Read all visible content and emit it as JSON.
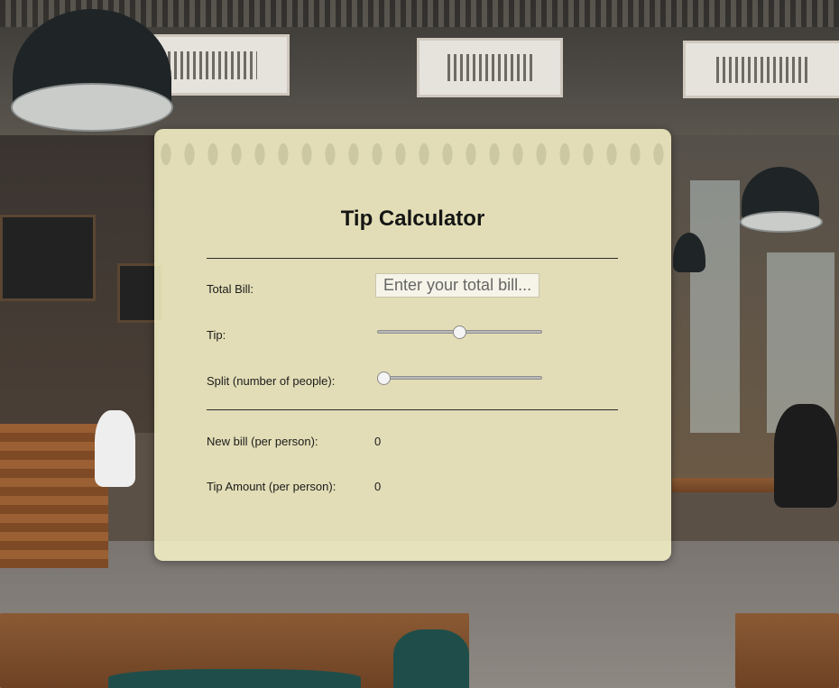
{
  "app": {
    "title": "Tip Calculator"
  },
  "form": {
    "total_bill_label": "Total Bill:",
    "total_bill_value": "",
    "total_bill_placeholder": "Enter your total bill...",
    "tip_label": "Tip:",
    "tip_slider_fraction": 0.5,
    "split_label": "Split (number of people):",
    "split_slider_fraction": 0.0
  },
  "results": {
    "new_bill_label": "New bill (per person):",
    "new_bill_value": "0",
    "tip_amount_label": "Tip Amount (per person):",
    "tip_amount_value": "0"
  },
  "theme": {
    "card_background": "#f8f5c8",
    "text_color": "#151515"
  }
}
